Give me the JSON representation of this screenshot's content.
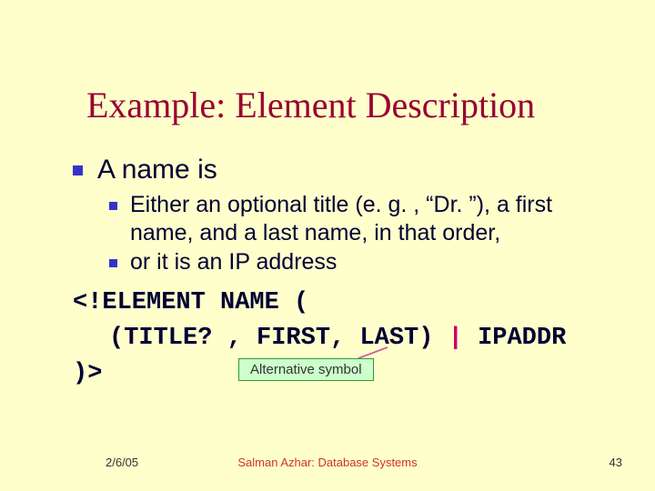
{
  "title": "Example: Element Description",
  "bullets": {
    "level1": "A name is",
    "level2": [
      "Either an optional title (e. g. , “Dr. ”), a first name, and a last name, in that order,",
      "or it is an IP address"
    ]
  },
  "code": {
    "line1": "<!ELEMENT NAME (",
    "line2_left": "(TITLE? , FIRST, LAST) ",
    "pipe": "|",
    "line2_right": " IPADDR",
    "line3": ")>"
  },
  "annotation": "Alternative symbol",
  "footer": {
    "date": "2/6/05",
    "center": "Salman Azhar: Database Systems",
    "page": "43"
  }
}
